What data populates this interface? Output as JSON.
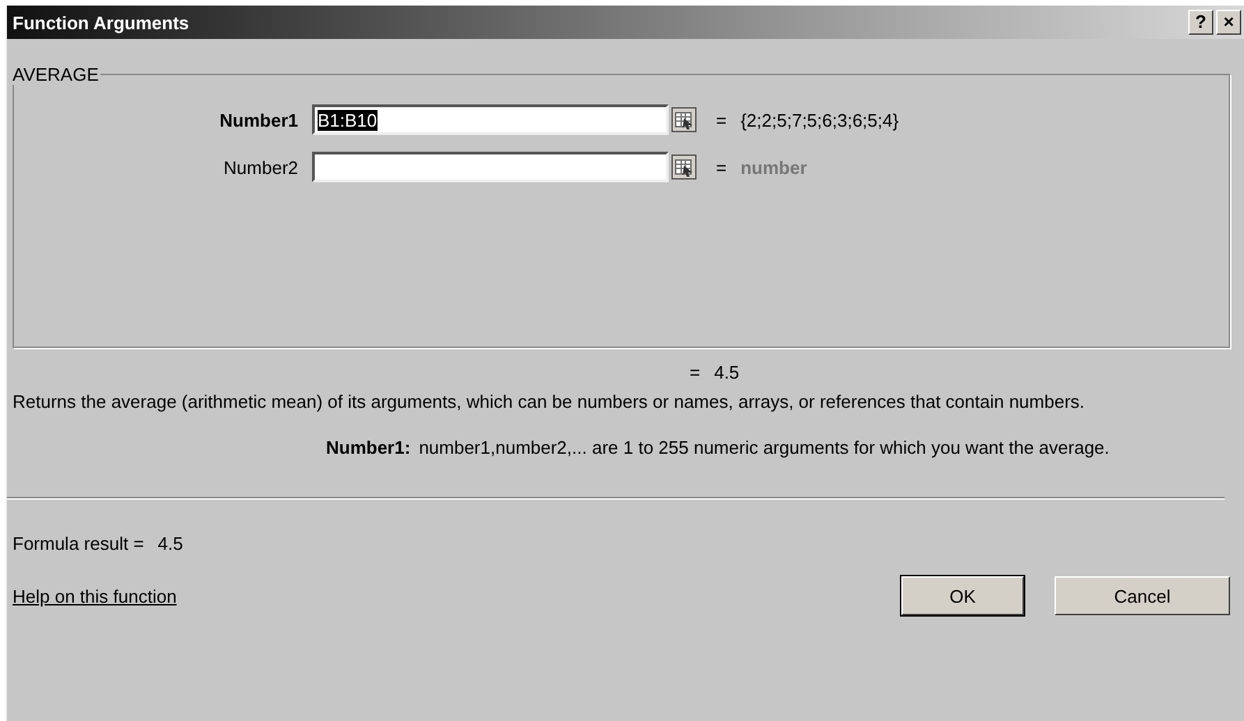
{
  "window": {
    "title": "Function Arguments",
    "help_button": "?",
    "close_button": "×"
  },
  "group": {
    "title": "AVERAGE"
  },
  "arguments": [
    {
      "label": "Number1",
      "required": true,
      "value": "B1:B10",
      "value_selected": true,
      "result": "{2;2;5;7;5;6;3;6;5;4}",
      "kind": "value"
    },
    {
      "label": "Number2",
      "required": false,
      "result": "number",
      "kind": "hint"
    }
  ],
  "function_result": "4.5",
  "equals": "=",
  "description": "Returns the average (arithmetic mean) of its arguments, which can be numbers or names, arrays, or references that contain numbers.",
  "argument_help": {
    "label": "Number1:",
    "text": "number1,number2,... are 1 to 255 numeric arguments for which you want the average."
  },
  "formula_result": {
    "label": "Formula result =",
    "value": "4.5"
  },
  "help_link": "Help on this function",
  "buttons": [
    "OK",
    "Cancel"
  ]
}
